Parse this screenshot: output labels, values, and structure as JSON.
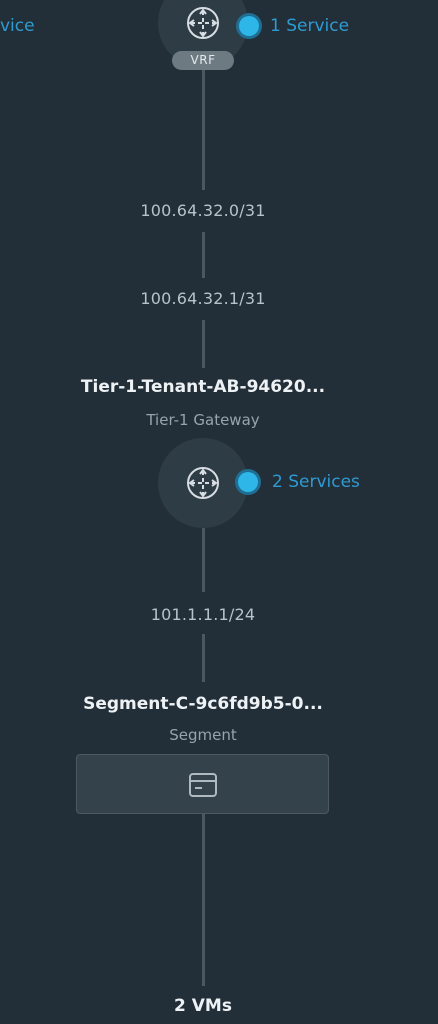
{
  "left_partial_label": "vice",
  "vrf": {
    "badge": "VRF",
    "services_label": "1 Service",
    "icon": "gateway-icon"
  },
  "uplink": {
    "subnet": "100.64.32.0/31",
    "interface_ip": "100.64.32.1/31"
  },
  "tier1": {
    "name": "Tier-1-Tenant-AB-94620...",
    "type": "Tier-1 Gateway",
    "services_label": "2 Services",
    "icon": "gateway-icon"
  },
  "downlink": {
    "interface_ip": "101.1.1.1/24"
  },
  "segment": {
    "name": "Segment-C-9c6fd9b5-0...",
    "type": "Segment",
    "icon": "vm-group-icon"
  },
  "vms": {
    "count_label": "2 VMs"
  },
  "colors": {
    "background": "#222f38",
    "accent": "#2fb6e8",
    "link": "#2e9bd2",
    "connector": "#4a5860"
  }
}
